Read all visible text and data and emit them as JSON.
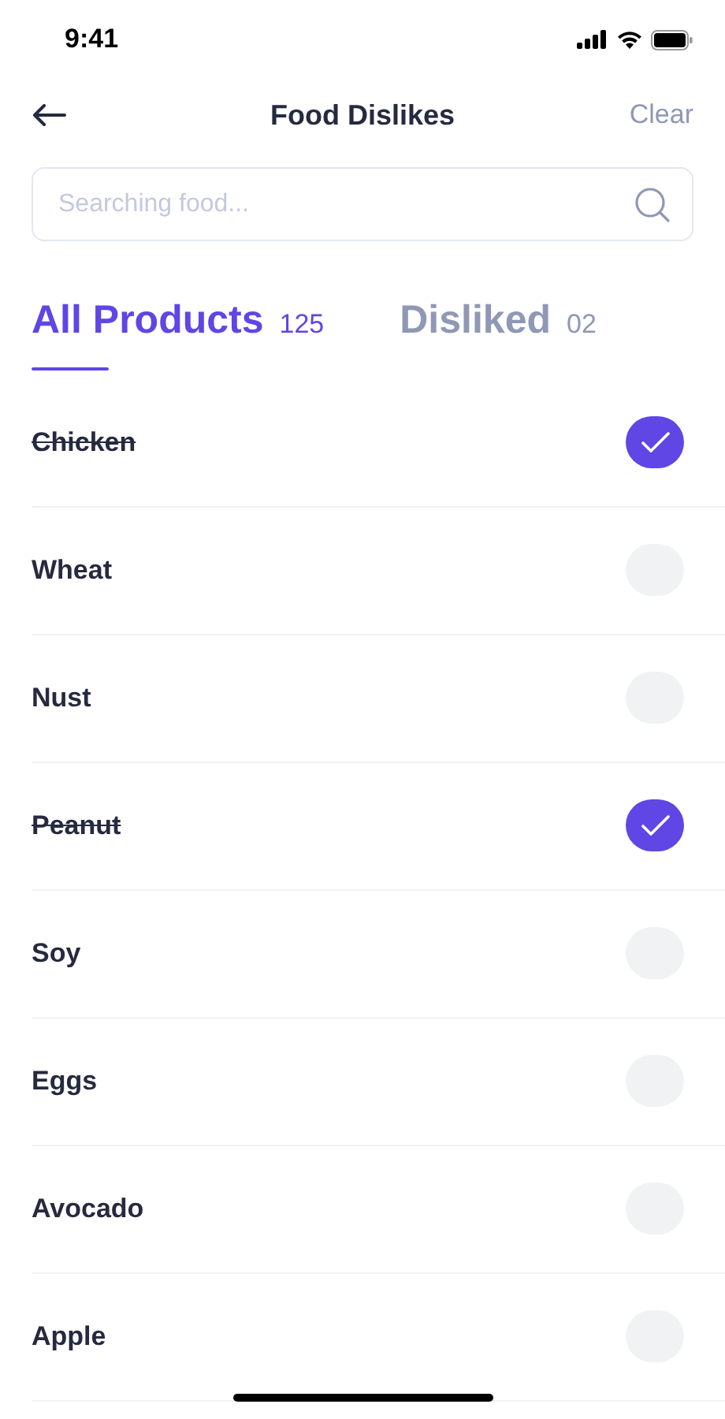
{
  "status_bar": {
    "time": "9:41"
  },
  "header": {
    "title": "Food Dislikes",
    "action": "Clear"
  },
  "search": {
    "placeholder": "Searching food..."
  },
  "tabs": [
    {
      "label": "All Products",
      "count": "125",
      "selected": true
    },
    {
      "label": "Disliked",
      "count": "02",
      "selected": false
    }
  ],
  "items": [
    {
      "name": "Chicken",
      "checked": true
    },
    {
      "name": "Wheat",
      "checked": false
    },
    {
      "name": "Nust",
      "checked": false
    },
    {
      "name": "Peanut",
      "checked": true
    },
    {
      "name": "Soy",
      "checked": false
    },
    {
      "name": "Eggs",
      "checked": false
    },
    {
      "name": "Avocado",
      "checked": false
    },
    {
      "name": "Apple",
      "checked": false
    }
  ]
}
